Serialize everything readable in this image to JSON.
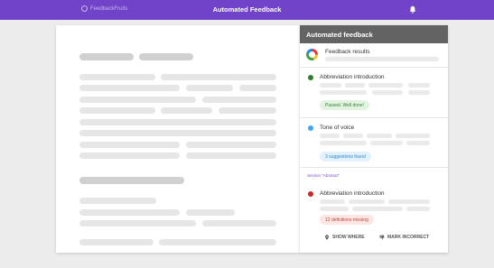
{
  "header": {
    "brand": "FeedbackFruits",
    "title": "Automated Feedback"
  },
  "panel": {
    "title": "Automated feedback",
    "summary": {
      "label": "Feedback results"
    },
    "items": [
      {
        "title": "Abbreviation introduction",
        "dot_color": "#2e7d32",
        "chip": "Passed. Well done!",
        "chip_kind": "green"
      },
      {
        "title": "Tone of voice",
        "dot_color": "#42a5f5",
        "chip": "3 suggestions found",
        "chip_kind": "blue"
      },
      {
        "title": "Abbreviation introduction",
        "dot_color": "#c62828",
        "chip": "12 definitions missing",
        "chip_kind": "red"
      }
    ],
    "section_label": "Section \"Abstract\"",
    "actions": {
      "show_where": "SHOW WHERE",
      "mark_incorrect": "MARK INCORRECT"
    }
  },
  "colors": {
    "topbar": "#7043c9",
    "panel_header": "#636363",
    "accent": "#7b4bc9"
  }
}
